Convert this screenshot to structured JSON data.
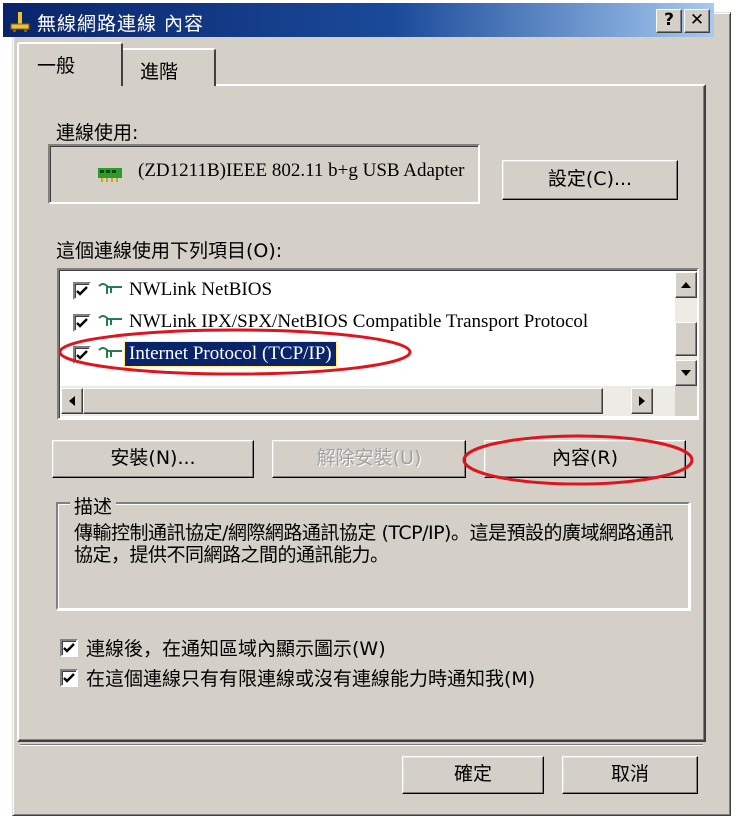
{
  "window": {
    "title": "無線網路連線 內容",
    "help_glyph": "?",
    "close_glyph": "✕"
  },
  "tabs": [
    {
      "label": "一般"
    },
    {
      "label": "進階"
    }
  ],
  "connect_using": {
    "label": "連線使用:",
    "adapter_name": "(ZD1211B)IEEE 802.11 b+g USB Adapter",
    "configure_button": "設定(C)..."
  },
  "components": {
    "label": "這個連線使用下列項目(O):",
    "items": [
      {
        "label": "NWLink NetBIOS",
        "checked": true,
        "selected": false
      },
      {
        "label": "NWLink IPX/SPX/NetBIOS Compatible Transport Protocol",
        "checked": true,
        "selected": false
      },
      {
        "label": "Internet Protocol (TCP/IP)",
        "checked": true,
        "selected": true
      }
    ]
  },
  "buttons": {
    "install": "安裝(N)...",
    "uninstall": "解除安裝(U)",
    "properties": "內容(R)",
    "ok": "確定",
    "cancel": "取消"
  },
  "description": {
    "legend": "描述",
    "text": "傳輸控制通訊協定/網際網路通訊協定 (TCP/IP)。這是預設的廣域網路通訊協定，提供不同網路之間的通訊能力。"
  },
  "options": [
    {
      "label": "連線後，在通知區域內顯示圖示(W)",
      "checked": true
    },
    {
      "label": "在這個連線只有有限連線或沒有連線能力時通知我(M)",
      "checked": true
    }
  ],
  "colors": {
    "face": "#d4d0c8",
    "title_start": "#0a246a",
    "title_end": "#a6caf0",
    "annotation": "#e0141e"
  }
}
